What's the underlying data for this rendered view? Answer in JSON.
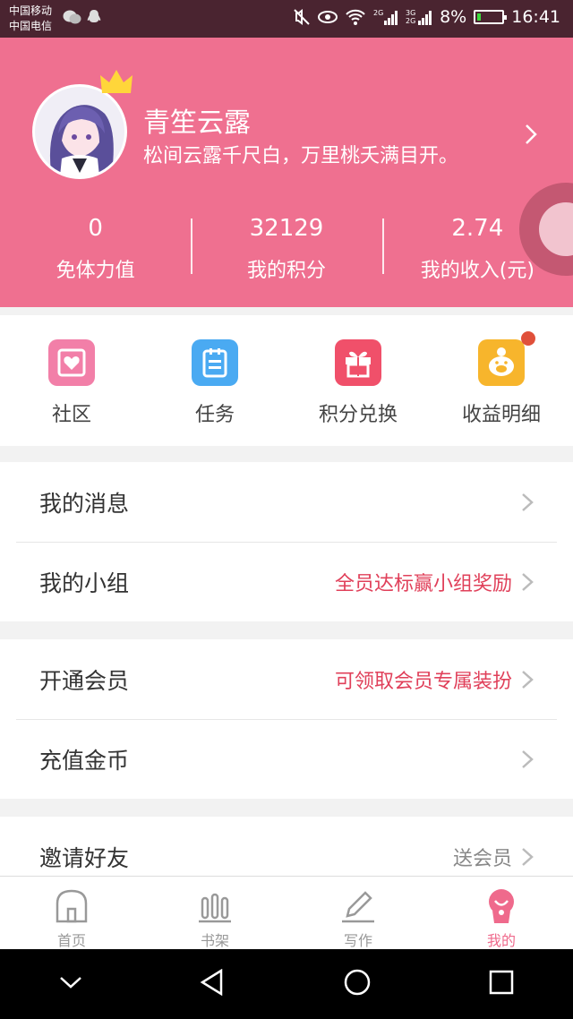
{
  "status_bar": {
    "carrier_1": "中国移动",
    "carrier_2": "中国电信",
    "battery": "8%",
    "time": "16:41",
    "icons": [
      "wechat-icon",
      "qq-icon",
      "mute-icon",
      "eye-icon",
      "wifi-icon",
      "signal-2g-icon",
      "signal-3g-icon",
      "battery-icon"
    ]
  },
  "profile": {
    "nickname": "青笙云露",
    "motto": "松间云露千尺白，万里桃夭满目开。"
  },
  "stats": [
    {
      "value": "0",
      "label": "免体力值"
    },
    {
      "value": "32129",
      "label": "我的积分"
    },
    {
      "value": "2.74",
      "label": "我的收入(元)"
    }
  ],
  "shortcuts": [
    {
      "label": "社区",
      "icon": "community-icon",
      "color": "#f27fa8"
    },
    {
      "label": "任务",
      "icon": "task-icon",
      "color": "#4aaaf2"
    },
    {
      "label": "积分兑换",
      "icon": "gift-icon",
      "color": "#f0506a"
    },
    {
      "label": "收益明细",
      "icon": "piggy-bank-icon",
      "color": "#f7b52c"
    }
  ],
  "menu": {
    "messages": {
      "title": "我的消息",
      "extra": ""
    },
    "group": {
      "title": "我的小组",
      "extra": "全员达标赢小组奖励"
    },
    "vip": {
      "title": "开通会员",
      "extra": "可领取会员专属装扮"
    },
    "recharge": {
      "title": "充值金币",
      "extra": ""
    },
    "invite": {
      "title": "邀请好友",
      "extra": "送会员"
    }
  },
  "bottom_nav": [
    {
      "label": "首页",
      "icon": "home-icon"
    },
    {
      "label": "书架",
      "icon": "bookshelf-icon"
    },
    {
      "label": "写作",
      "icon": "pen-icon"
    },
    {
      "label": "我的",
      "icon": "profile-icon",
      "active": true
    }
  ],
  "colors": {
    "header": "#ef7090",
    "accent_text": "#e0405a",
    "active_nav": "#ef6a8c"
  }
}
